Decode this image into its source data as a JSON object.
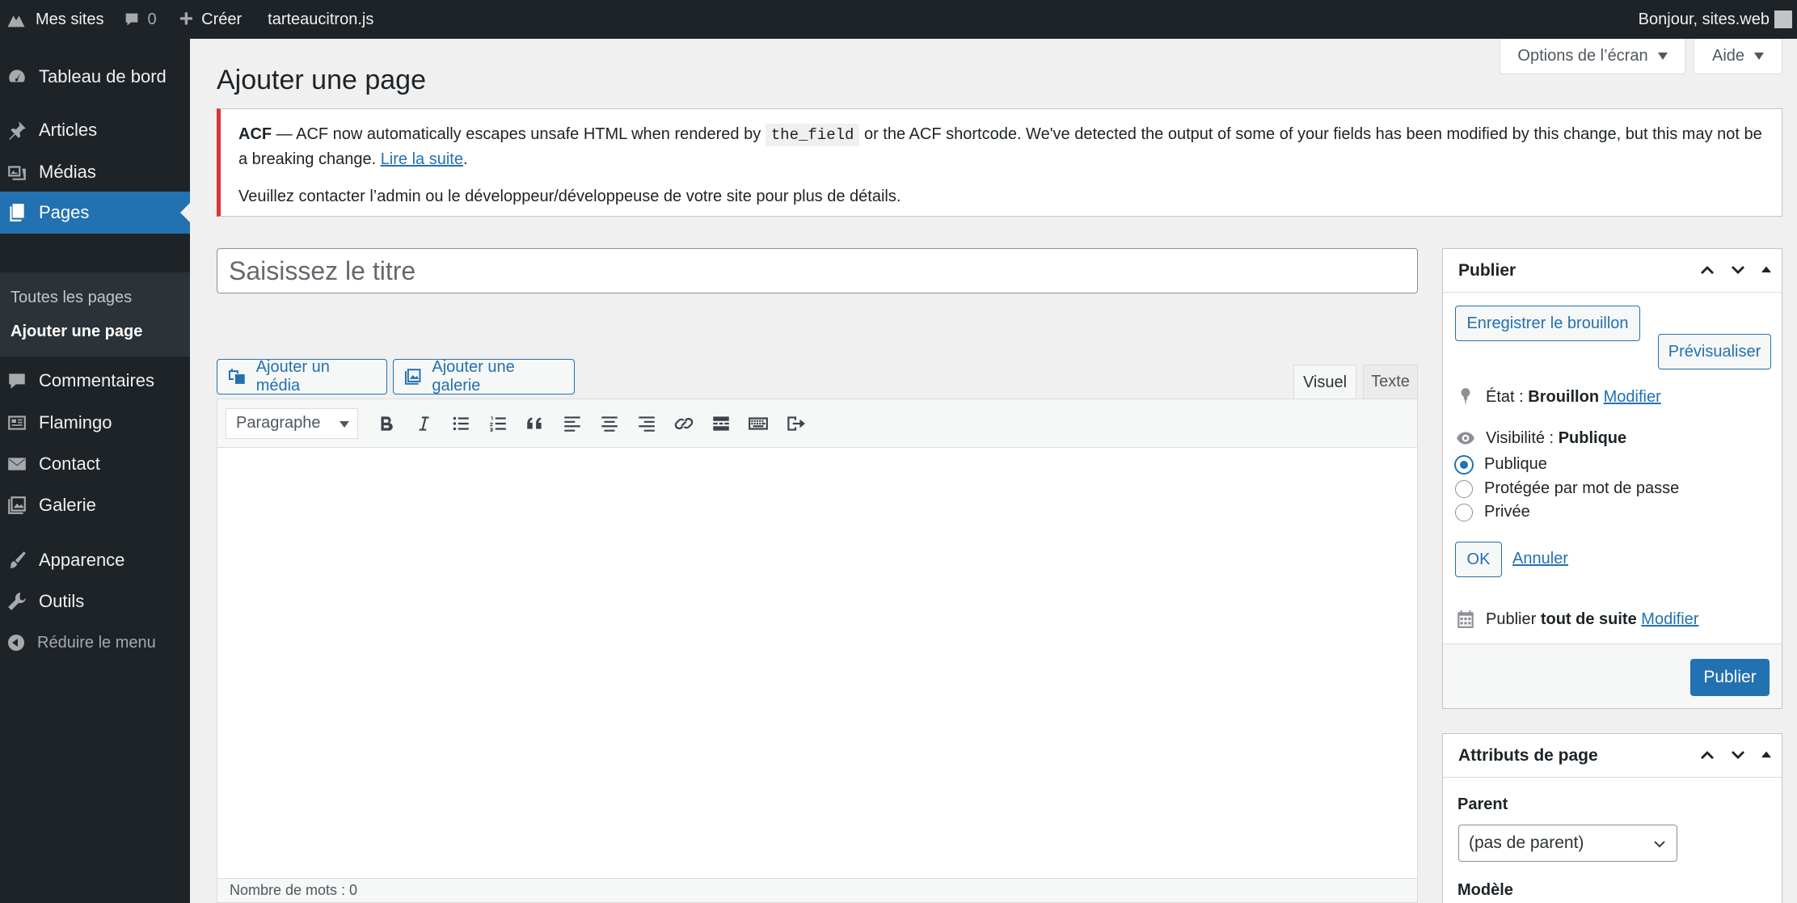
{
  "adminbar": {
    "my_sites": "Mes sites",
    "comments_count": "0",
    "new_label": "Créer",
    "site_name": "tarteaucitron.js",
    "greeting": "Bonjour, sites.web"
  },
  "sidebar": {
    "items": [
      {
        "label": "Tableau de bord",
        "icon": "dashboard-icon"
      },
      {
        "label": "Articles",
        "icon": "pin-icon"
      },
      {
        "label": "Médias",
        "icon": "media-icon"
      },
      {
        "label": "Pages",
        "icon": "pages-icon"
      },
      {
        "label": "Commentaires",
        "icon": "comment-icon"
      },
      {
        "label": "Flamingo",
        "icon": "feedback-icon"
      },
      {
        "label": "Contact",
        "icon": "email-icon"
      },
      {
        "label": "Galerie",
        "icon": "gallery-icon"
      },
      {
        "label": "Apparence",
        "icon": "brush-icon"
      },
      {
        "label": "Outils",
        "icon": "wrench-icon"
      }
    ],
    "submenu": [
      "Toutes les pages",
      "Ajouter une page"
    ],
    "collapse_label": "Réduire le menu"
  },
  "screen_options": "Options de l’écran",
  "help": "Aide",
  "page_title": "Ajouter une page",
  "notice": {
    "prefix": "ACF",
    "text_before_code": " — ACF now automatically escapes unsafe HTML when rendered by ",
    "code": "the_field",
    "text_after_code": " or the ACF shortcode. We've detected the output of some of your fields has been modified by this change, but this may not be a breaking change. ",
    "link": "Lire la suite",
    "after_link": ".",
    "second_line": "Veuillez contacter l’admin ou le développeur/développeuse de votre site pour plus de détails."
  },
  "title_placeholder": "Saisissez le titre",
  "media_buttons": {
    "add_media": "Ajouter un média",
    "add_gallery": "Ajouter une galerie"
  },
  "editor_tabs": {
    "visual": "Visuel",
    "text": "Texte"
  },
  "toolbar": {
    "format": "Paragraphe"
  },
  "word_count": "Nombre de mots : 0",
  "publish_box": {
    "title": "Publier",
    "save_draft": "Enregistrer le brouillon",
    "preview": "Prévisualiser",
    "status_label": "État :",
    "status_value": "Brouillon",
    "modify": "Modifier",
    "visibility_label": "Visibilité :",
    "visibility_value": "Publique",
    "visibility_options": [
      "Publique",
      "Protégée par mot de passe",
      "Privée"
    ],
    "ok": "OK",
    "cancel": "Annuler",
    "publish_label": "Publier",
    "publish_when": "tout de suite",
    "publish_button": "Publier"
  },
  "page_attributes": {
    "title": "Attributs de page",
    "parent_label": "Parent",
    "parent_value": "(pas de parent)",
    "model_label": "Modèle"
  },
  "colors": {
    "accent": "#2271b1",
    "menu_bg": "#1d2327",
    "notice_error": "#d63638"
  }
}
